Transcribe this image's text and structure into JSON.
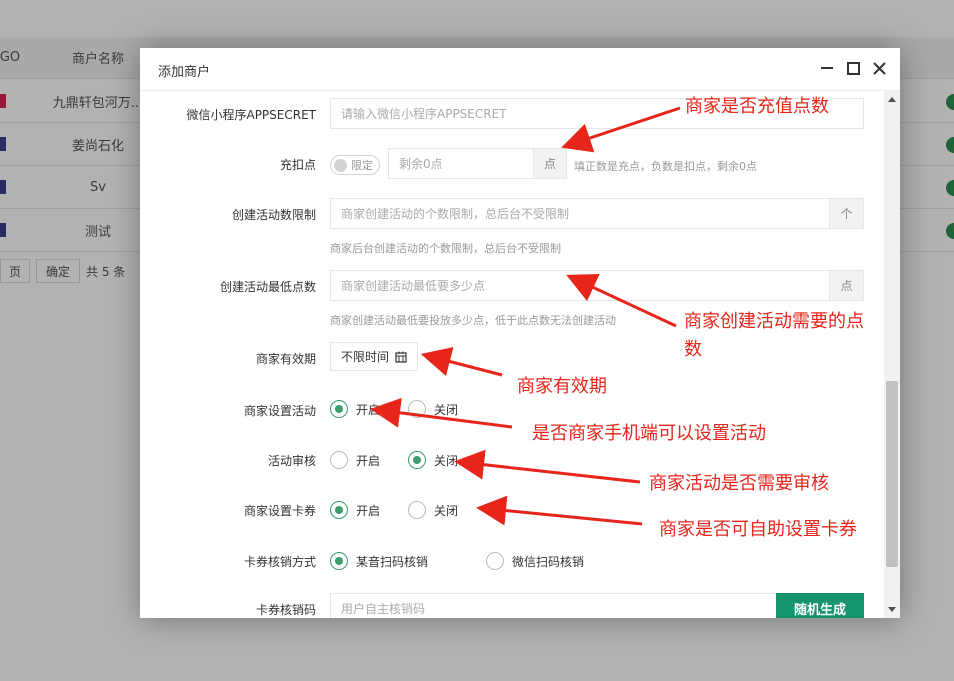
{
  "background": {
    "columns": [
      "GO",
      "商户名称"
    ],
    "rows": [
      {
        "name": "九鼎轩包河万..."
      },
      {
        "name": "姜尚石化"
      },
      {
        "name": "Sv"
      },
      {
        "name": "测试"
      }
    ],
    "pager": {
      "page_suffix": "页",
      "confirm": "确定",
      "total": "共 5 条"
    }
  },
  "modal": {
    "title": "添加商户",
    "fields": {
      "appsecret": {
        "label": "微信小程序APPSECRET",
        "placeholder": "请输入微信小程序APPSECRET"
      },
      "recharge": {
        "label": "充扣点",
        "toggle_text": "限定",
        "placeholder": "剩余0点",
        "addon": "点",
        "hint": "填正数是充点，负数是扣点，剩余0点"
      },
      "activity_limit": {
        "label": "创建活动数限制",
        "placeholder": "商家创建活动的个数限制，总后台不受限制",
        "addon": "个",
        "hint": "商家后台创建活动的个数限制，总后台不受限制"
      },
      "min_points": {
        "label": "创建活动最低点数",
        "placeholder": "商家创建活动最低要多少点",
        "addon": "点",
        "hint": "商家创建活动最低要投放多少点，低于此点数无法创建活动"
      },
      "validity": {
        "label": "商家有效期",
        "value": "不限时间"
      },
      "set_activity": {
        "label": "商家设置活动",
        "options": [
          "开启",
          "关闭"
        ],
        "selected": 0
      },
      "activity_review": {
        "label": "活动审核",
        "options": [
          "开启",
          "关闭"
        ],
        "selected": 1
      },
      "set_coupon": {
        "label": "商家设置卡券",
        "options": [
          "开启",
          "关闭"
        ],
        "selected": 0
      },
      "coupon_verify_method": {
        "label": "卡券核销方式",
        "options": [
          "某音扫码核销",
          "微信扫码核销"
        ],
        "selected": 0
      },
      "coupon_verify_code": {
        "label": "卡券核销码",
        "placeholder": "用户自主核销码",
        "button": "随机生成"
      }
    }
  },
  "annotations": {
    "recharge": "商家是否充值点数",
    "min_points_line1": "商家创建活动需要的点",
    "min_points_line2": "数",
    "validity": "商家有效期",
    "set_activity": "是否商家手机端可以设置活动",
    "review": "商家活动是否需要审核",
    "coupon": "商家是否可自助设置卡券",
    "color": "#e8251b"
  }
}
